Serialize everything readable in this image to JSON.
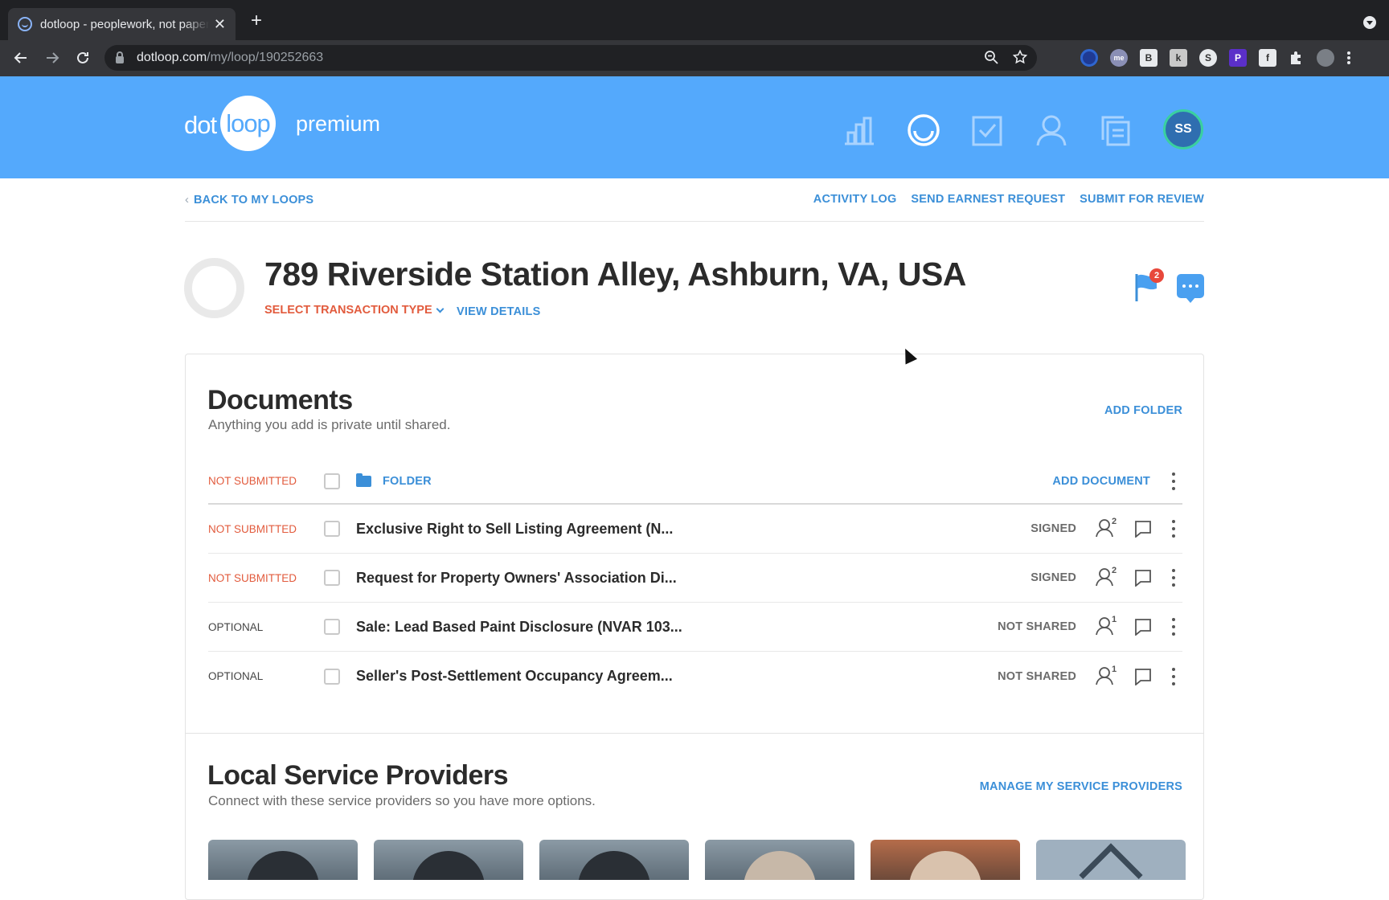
{
  "browser": {
    "tab_title": "dotloop - peoplework, not paperwork",
    "tab_close": "✕",
    "new_tab": "+",
    "url_host": "dotloop.com",
    "url_path": "/my/loop/190252663",
    "icons": [
      "back-icon",
      "forward-icon",
      "reload-icon",
      "zoom-icon",
      "star-icon",
      "extensions-icon",
      "menu-icon"
    ]
  },
  "header": {
    "logo_left": "dot",
    "logo_circle": "loop",
    "logo_tier": "premium",
    "avatar_initials": "SS",
    "brand_color": "#54a9fc"
  },
  "subnav": {
    "back_label": "BACK TO MY LOOPS",
    "activity_log": "ACTIVITY LOG",
    "send_earnest": "SEND EARNEST REQUEST",
    "submit_review": "SUBMIT FOR REVIEW"
  },
  "loop": {
    "title": "789 Riverside Station Alley, Ashburn, VA, USA",
    "transaction_type_label": "SELECT TRANSACTION TYPE",
    "view_details": "VIEW DETAILS",
    "flag_count": "2"
  },
  "documents": {
    "title": "Documents",
    "subtitle": "Anything you add is private until shared.",
    "add_folder": "ADD FOLDER",
    "folder_row": {
      "status": "NOT SUBMITTED",
      "folder_label": "FOLDER",
      "add_document": "ADD DOCUMENT"
    },
    "rows": [
      {
        "status": "NOT SUBMITTED",
        "status_kind": "ns",
        "name": "Exclusive Right to Sell Listing Agreement (N...",
        "state": "SIGNED",
        "participants": "2"
      },
      {
        "status": "NOT SUBMITTED",
        "status_kind": "ns",
        "name": "Request for Property Owners' Association Di...",
        "state": "SIGNED",
        "participants": "2"
      },
      {
        "status": "OPTIONAL",
        "status_kind": "opt",
        "name": "Sale: Lead Based Paint Disclosure (NVAR 103...",
        "state": "NOT SHARED",
        "participants": "1"
      },
      {
        "status": "OPTIONAL",
        "status_kind": "opt",
        "name": "Seller's Post-Settlement Occupancy Agreem...",
        "state": "NOT SHARED",
        "participants": "1"
      }
    ]
  },
  "providers": {
    "title": "Local Service Providers",
    "subtitle": "Connect with these service providers so you have more options.",
    "manage": "MANAGE MY SERVICE PROVIDERS"
  }
}
